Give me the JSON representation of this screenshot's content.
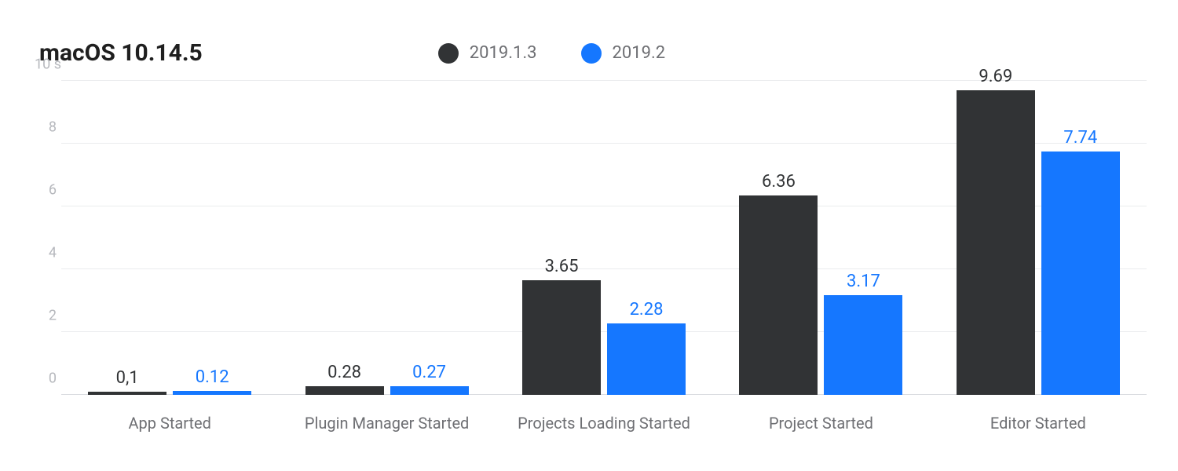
{
  "title": "macOS 10.14.5",
  "legend": [
    {
      "label": "2019.1.3",
      "color": "#313335"
    },
    {
      "label": "2019.2",
      "color": "#1577ff"
    }
  ],
  "chart_data": {
    "type": "bar",
    "title": "macOS 10.14.5",
    "xlabel": "",
    "ylabel": "",
    "ylim": [
      0,
      10
    ],
    "y_unit": "s",
    "y_ticks": [
      0,
      2,
      4,
      6,
      8,
      10
    ],
    "y_tick_top_label": "10 s",
    "categories": [
      "App Started",
      "Plugin Manager Started",
      "Projects Loading Started",
      "Project Started",
      "Editor Started"
    ],
    "series": [
      {
        "name": "2019.1.3",
        "color": "#313335",
        "values": [
          0.1,
          0.28,
          3.65,
          6.36,
          9.69
        ],
        "value_labels": [
          "0,1",
          "0.28",
          "3.65",
          "6.36",
          "9.69"
        ]
      },
      {
        "name": "2019.2",
        "color": "#1577ff",
        "values": [
          0.12,
          0.27,
          2.28,
          3.17,
          7.74
        ],
        "value_labels": [
          "0.12",
          "0.27",
          "2.28",
          "3.17",
          "7.74"
        ]
      }
    ]
  }
}
